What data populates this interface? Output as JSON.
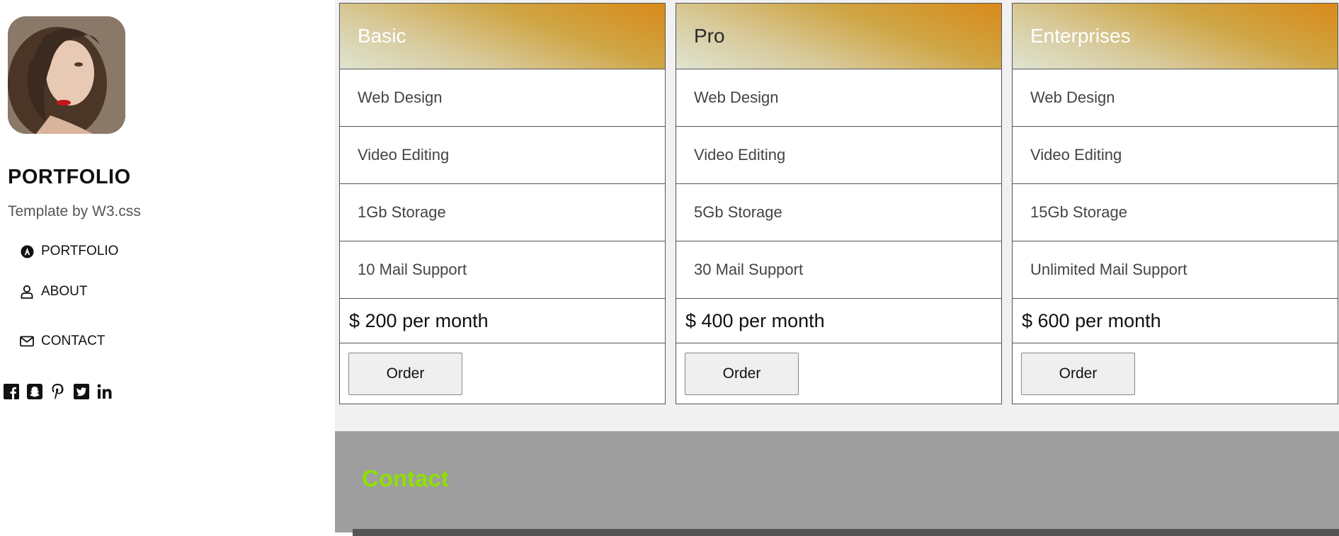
{
  "sidebar": {
    "title": "PORTFOLIO",
    "subtitle": "Template by W3.css",
    "nav": [
      {
        "label": "PORTFOLIO",
        "icon": "a-circle-icon"
      },
      {
        "label": "ABOUT",
        "icon": "user-icon"
      },
      {
        "label": "CONTACT",
        "icon": "envelope-icon"
      }
    ],
    "socials": [
      "facebook-icon",
      "snapchat-icon",
      "pinterest-icon",
      "twitter-icon",
      "linkedin-icon"
    ]
  },
  "pricing": {
    "plans": [
      {
        "name": "Basic",
        "features": [
          "Web Design",
          "Video Editing",
          "1Gb Storage",
          "10 Mail Support"
        ],
        "price": "$ 200 per month",
        "order_label": "Order"
      },
      {
        "name": "Pro",
        "features": [
          "Web Design",
          "Video Editing",
          "5Gb Storage",
          "30 Mail Support"
        ],
        "price": "$ 400 per month",
        "order_label": "Order"
      },
      {
        "name": "Enterprises",
        "features": [
          "Web Design",
          "Video Editing",
          "15Gb Storage",
          "Unlimited Mail Support"
        ],
        "price": "$ 600 per month",
        "order_label": "Order"
      }
    ]
  },
  "contact": {
    "title": "Contact"
  },
  "colors": {
    "header_gradient_start": "#d98a1a",
    "header_gradient_end": "#dfe3d0",
    "contact_bg": "#9e9e9e",
    "contact_title": "#8ee000"
  }
}
